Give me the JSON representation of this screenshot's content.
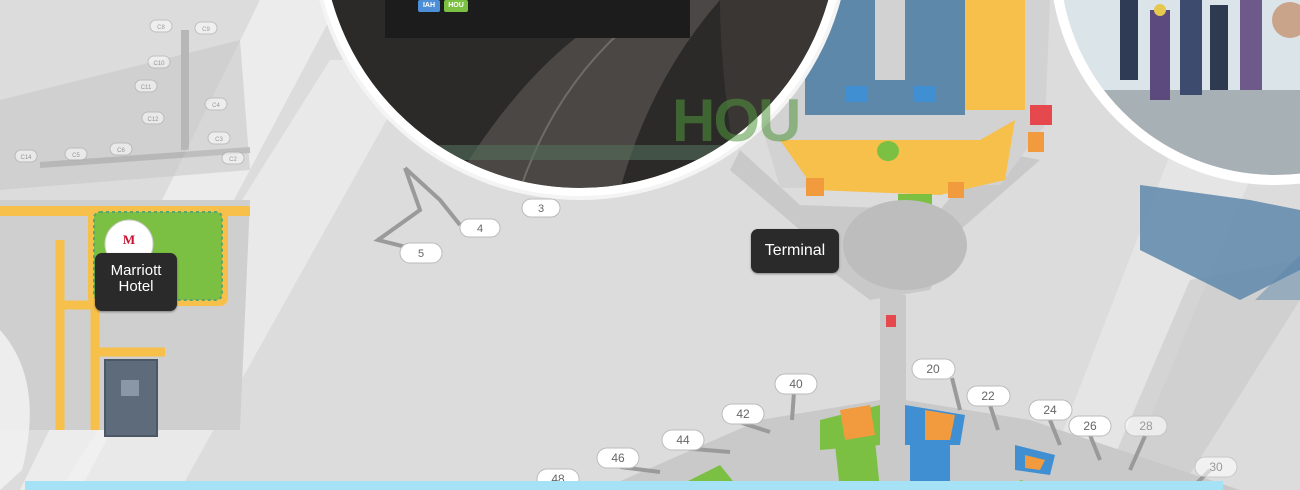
{
  "labels": {
    "terminal": "Terminal",
    "hotel_line1": "Marriott",
    "hotel_line2": "Hotel",
    "watermark": "HOU",
    "badge_iah": "IAH",
    "badge_hou": "HOU",
    "hotel_brand": "MARRIOTT"
  },
  "gates_left": [
    {
      "id": "g3",
      "label": "3"
    },
    {
      "id": "g4",
      "label": "4"
    },
    {
      "id": "g5",
      "label": "5"
    }
  ],
  "gates_concourse": [
    {
      "id": "g20",
      "label": "20"
    },
    {
      "id": "g22",
      "label": "22"
    },
    {
      "id": "g24",
      "label": "24"
    },
    {
      "id": "g26",
      "label": "26"
    },
    {
      "id": "g28",
      "label": "28"
    },
    {
      "id": "g30",
      "label": "30"
    },
    {
      "id": "g40",
      "label": "40"
    },
    {
      "id": "g42",
      "label": "42"
    },
    {
      "id": "g44",
      "label": "44"
    },
    {
      "id": "g46",
      "label": "46"
    },
    {
      "id": "g48",
      "label": "48"
    }
  ],
  "gates_west": [
    {
      "id": "gC8",
      "label": "C8"
    },
    {
      "id": "gC9",
      "label": "C9"
    },
    {
      "id": "gC10",
      "label": "C10"
    },
    {
      "id": "gC11",
      "label": "C11"
    },
    {
      "id": "gC12",
      "label": "C12"
    },
    {
      "id": "gC4",
      "label": "C4"
    },
    {
      "id": "gC3",
      "label": "C3"
    },
    {
      "id": "gC2",
      "label": "C2"
    },
    {
      "id": "gC6",
      "label": "C6"
    },
    {
      "id": "gC5",
      "label": "C5"
    },
    {
      "id": "gC14",
      "label": "C14"
    }
  ],
  "colors": {
    "map_bg": "#dcdcdc",
    "terminal_floor": "#c9c9c9",
    "food_yellow": "#f7c04a",
    "shop_orange": "#f19a3e",
    "service_blue": "#3f8fd2",
    "green_space": "#7cc043",
    "restroom_red": "#e5484d",
    "parking_blue": "#5e88aa",
    "accent_cyan": "#a6e2f6",
    "label_dark": "#2a2a2a"
  }
}
